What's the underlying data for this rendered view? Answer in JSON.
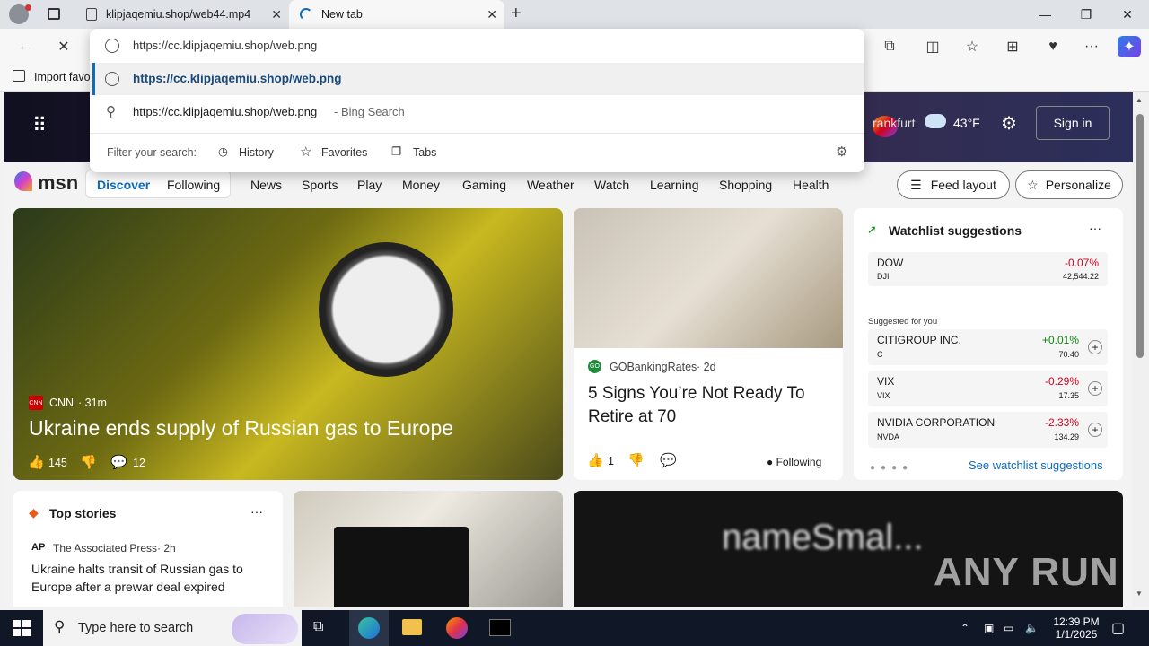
{
  "tabs": [
    {
      "title": "klipjaqemiu.shop/web44.mp4"
    },
    {
      "title": "New tab"
    }
  ],
  "window": {
    "minimize": "—",
    "maximize": "❐",
    "close": "✕"
  },
  "omnibox": {
    "value": "https://cc.klipjaqemiu.shop/web.png",
    "suggestion_url": "https://cc.klipjaqemiu.shop/web.png",
    "suggestion_search": "https://cc.klipjaqemiu.shop/web.png",
    "suggestion_search_suffix": "- Bing Search",
    "filter_label": "Filter your search:",
    "filters": [
      "History",
      "Favorites",
      "Tabs"
    ]
  },
  "favbar": {
    "import": "Import favo"
  },
  "hero": {
    "location": "rankfurt",
    "temp": "43",
    "unit": "°F",
    "signin": "Sign in"
  },
  "msn": {
    "logo": "msn",
    "tabs": [
      "Discover",
      "Following"
    ],
    "nav": [
      "News",
      "Sports",
      "Play",
      "Money",
      "Gaming",
      "Weather",
      "Watch",
      "Learning",
      "Shopping",
      "Health"
    ],
    "feed_layout": "Feed layout",
    "personalize": "Personalize"
  },
  "main_story": {
    "source": "CNN",
    "age": "· 31m",
    "title": "Ukraine ends supply of Russian gas to Europe",
    "likes": "145",
    "comments": "12",
    "source_badge": "CNN"
  },
  "story2": {
    "source": "GOBankingRates",
    "age": "· 2d",
    "title": "5 Signs You’re Not Ready To Retire at 70",
    "likes": "1",
    "following": "Following",
    "source_badge": "GO"
  },
  "watchlist": {
    "title": "Watchlist suggestions",
    "more": "···",
    "dow": {
      "name": "DOW",
      "sym": "DJI",
      "change": "-0.07%",
      "price": "42,544.22"
    },
    "suggested_label": "Suggested for you",
    "items": [
      {
        "name": "CITIGROUP INC.",
        "sym": "C",
        "change": "+0.01%",
        "price": "70.40",
        "color": "#0a8a0a"
      },
      {
        "name": "VIX",
        "sym": "VIX",
        "change": "-0.29%",
        "price": "17.35",
        "color": "#d0021b"
      },
      {
        "name": "NVIDIA CORPORATION",
        "sym": "NVDA",
        "change": "-2.33%",
        "price": "134.29",
        "color": "#d0021b"
      }
    ],
    "see_more": "See watchlist suggestions"
  },
  "top_stories": {
    "title": "Top stories",
    "more": "···",
    "source": "The Associated Press",
    "age": "· 2h",
    "headline": "Ukraine halts transit of Russian gas to Europe after a prewar deal expired",
    "source_badge": "AP"
  },
  "bottom_image": {
    "text": "nameSmal..."
  },
  "watermark": "ANY RUN",
  "taskbar": {
    "search_placeholder": "Type here to search",
    "time": "12:39 PM",
    "date": "1/1/2025"
  },
  "colors": {
    "accent": "#0f6cbd",
    "negative": "#d0021b",
    "positive": "#0a8a0a"
  }
}
